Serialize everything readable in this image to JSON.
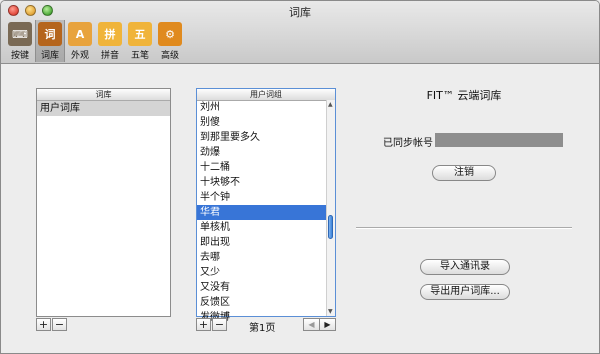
{
  "window": {
    "title": "词库"
  },
  "toolbar": [
    {
      "label": "按键",
      "icon": "keyboard-icon",
      "glyph": "⌨",
      "color": "#7a6a55"
    },
    {
      "label": "词库",
      "icon": "dictionary-book-icon",
      "glyph": "词",
      "color": "#b5651d"
    },
    {
      "label": "外观",
      "icon": "appearance-icon",
      "glyph": "A",
      "color": "#e8a33d"
    },
    {
      "label": "拼音",
      "icon": "pinyin-icon",
      "glyph": "拼",
      "color": "#f0b43a"
    },
    {
      "label": "五笔",
      "icon": "wubi-icon",
      "glyph": "五",
      "color": "#f0b43a"
    },
    {
      "label": "高级",
      "icon": "gear-icon",
      "glyph": "⚙",
      "color": "#e08a1e"
    }
  ],
  "dict_list": {
    "header": "词库",
    "items": [
      "用户词库"
    ],
    "selected_index": 0
  },
  "word_list": {
    "header": "用户词组",
    "items": [
      "刘州",
      "别傻",
      "到那里要多久",
      "劲爆",
      "十二桶",
      "十块够不",
      "半个钟",
      "华君",
      "单核机",
      "即出现",
      "去哪",
      "又少",
      "又没有",
      "反馈区",
      "发微博"
    ],
    "selected_index": 7,
    "page_label": "第1页"
  },
  "cloud": {
    "title": "FIT™ 云端词库",
    "synced_account_label": "已同步帐号",
    "logout_label": "注销",
    "import_contacts_label": "导入通讯录",
    "export_user_dict_label": "导出用户词库..."
  },
  "controls": {
    "add": "+",
    "remove": "−",
    "prev": "◀",
    "next": "▶"
  }
}
